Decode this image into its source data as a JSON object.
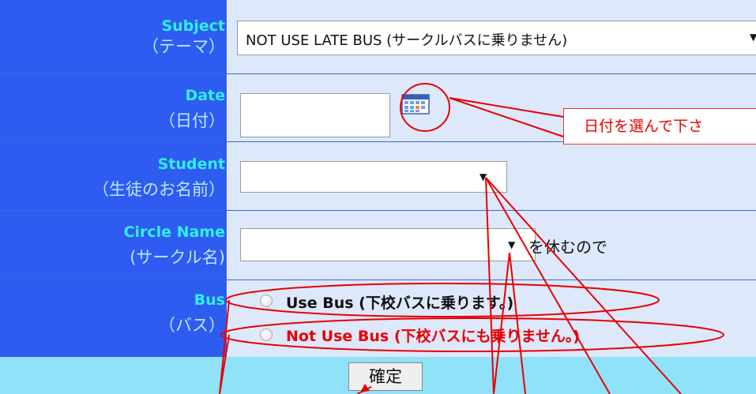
{
  "form": {
    "subject": {
      "label_en": "Subject",
      "label_jp": "（テーマ）",
      "value": "NOT USE LATE BUS (サークルバスに乗りません)"
    },
    "date": {
      "label_en": "Date",
      "label_jp": "（日付）",
      "value": "",
      "tooltip": "日付を選んで下さ"
    },
    "student": {
      "label_en": "Student",
      "label_jp": "（生徒のお名前）",
      "value": ""
    },
    "circle": {
      "label_en": "Circle Name",
      "label_jp": "(サークル名)",
      "value": "",
      "suffix": "を休むので"
    },
    "bus": {
      "label_en": "Bus",
      "label_jp": "（バス）",
      "options": [
        {
          "label": "Use Bus (下校バスに乗ります。)",
          "color": "#111111"
        },
        {
          "label": "Not Use Bus (下校バスにも乗りません。)",
          "color": "#e80000"
        }
      ]
    },
    "submit_label": "確定"
  },
  "colors": {
    "label_bg": "#2f5cf0",
    "label_en": "#2ef0ee",
    "label_jp": "#b8e6ff",
    "value_bg": "#dde8fb",
    "submit_bg": "#8fe2f8",
    "annotation": "#e80000"
  },
  "icons": {
    "calendar": "calendar-icon",
    "dropdown": "dropdown-caret-icon"
  }
}
